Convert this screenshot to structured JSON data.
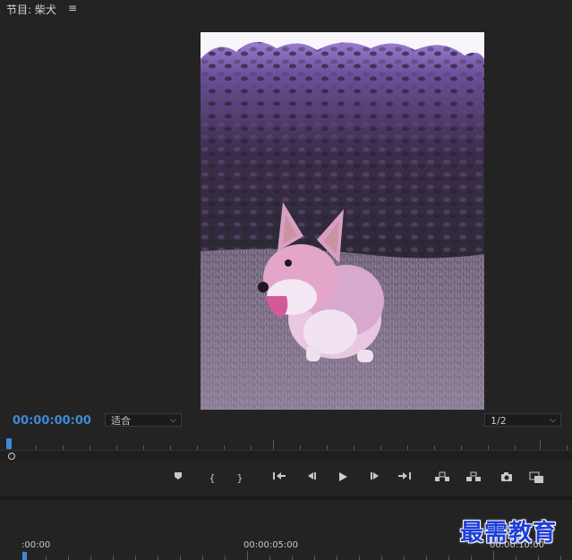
{
  "panel": {
    "title": "节目: 柴犬",
    "menu_icon": "hamburger-menu-icon"
  },
  "monitor": {
    "timecode": "00:00:00:00",
    "zoom_value": "适合",
    "resolution_value": "1/2",
    "frame_subject": "corgi-photo"
  },
  "transport": {
    "buttons": [
      {
        "name": "add-marker",
        "icon": "marker-icon"
      },
      {
        "name": "mark-in",
        "icon": "mark-in-icon"
      },
      {
        "name": "mark-out",
        "icon": "mark-out-icon"
      },
      {
        "name": "go-to-in",
        "icon": "go-to-in-icon"
      },
      {
        "name": "step-back",
        "icon": "step-back-icon"
      },
      {
        "name": "play",
        "icon": "play-icon"
      },
      {
        "name": "step-forward",
        "icon": "step-forward-icon"
      },
      {
        "name": "go-to-out",
        "icon": "go-to-out-icon"
      },
      {
        "name": "lift",
        "icon": "lift-icon"
      },
      {
        "name": "extract",
        "icon": "extract-icon"
      },
      {
        "name": "export-frame",
        "icon": "camera-icon"
      },
      {
        "name": "comparison-view",
        "icon": "compare-icon"
      }
    ]
  },
  "timeline": {
    "labels": [
      ":00:00",
      "00:00:05:00",
      "00:00:10:00"
    ]
  },
  "watermark": "最需教育",
  "colors": {
    "background": "#232323",
    "accent": "#3d8bd6",
    "watermark": "#1e3fd8"
  }
}
